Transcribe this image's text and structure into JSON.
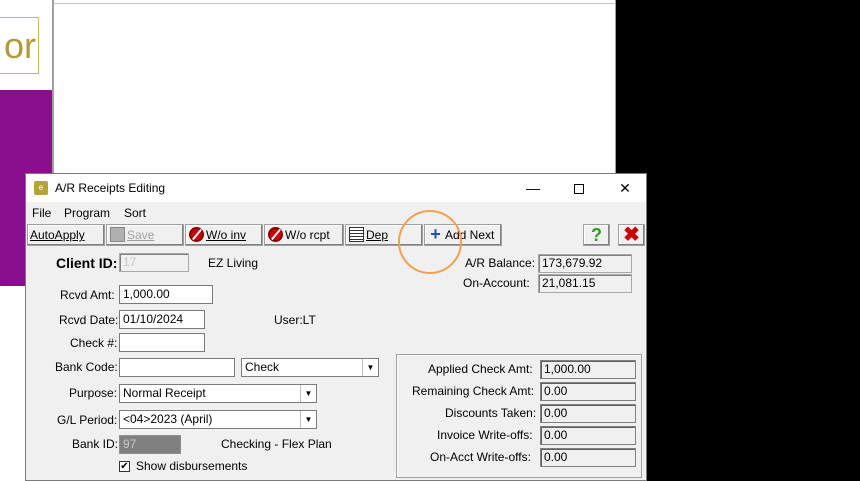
{
  "background": {
    "logo_text": "or"
  },
  "window": {
    "title": "A/R Receipts Editing",
    "icon_text": "e"
  },
  "menu": [
    "File",
    "Program",
    "Sort"
  ],
  "toolbar": {
    "autoapply": "AutoApply",
    "save": "Save",
    "wo_inv": "W/o inv",
    "wo_rcpt": "W/o rcpt",
    "dep": "Dep",
    "add_next": "Add Next",
    "help": "?",
    "close": "✖"
  },
  "form": {
    "client_id_label": "Client ID:",
    "client_id_value": "17",
    "client_name": "EZ Living",
    "rcvd_amt_label": "Rcvd Amt:",
    "rcvd_amt_value": "1,000.00",
    "rcvd_date_label": "Rcvd Date:",
    "rcvd_date_value": "01/10/2024",
    "user_text": "User:LT",
    "check_no_label": "Check #:",
    "check_no_value": "",
    "bank_code_label": "Bank Code:",
    "bank_code_value": "",
    "payment_type": "Check",
    "purpose_label": "Purpose:",
    "purpose_value": "Normal Receipt",
    "gl_period_label": "G/L Period:",
    "gl_period_value": "<04>2023 (April)",
    "bank_id_label": "Bank ID:",
    "bank_id_value": "97",
    "bank_id_desc": "Checking - Flex Plan",
    "show_disb_label": "Show disbursements",
    "show_disb_checked": true
  },
  "balances": {
    "ar_balance_label": "A/R Balance:",
    "ar_balance_value": "173,679.92",
    "on_account_label": "On-Account:",
    "on_account_value": "21,081.15"
  },
  "totals": {
    "applied_label": "Applied Check Amt:",
    "applied_value": "1,000.00",
    "remaining_label": "Remaining Check Amt:",
    "remaining_value": "0.00",
    "discounts_label": "Discounts Taken:",
    "discounts_value": "0.00",
    "invoice_wo_label": "Invoice Write-offs:",
    "invoice_wo_value": "0.00",
    "onacct_wo_label": "On-Acct Write-offs:",
    "onacct_wo_value": "0.00"
  },
  "colors": {
    "purple_bar": "#8a0f8e",
    "highlight_circle": "#f0a050"
  }
}
